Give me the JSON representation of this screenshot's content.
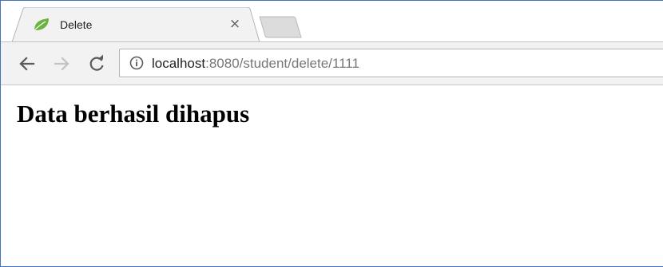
{
  "tab": {
    "title": "Delete",
    "close_glyph": "×",
    "favicon": "spring-leaf-icon",
    "favicon_color": "#6db33f"
  },
  "toolbar": {
    "back_icon": "arrow-left-icon",
    "forward_icon": "arrow-right-icon",
    "reload_icon": "reload-icon",
    "site_info_icon": "info-circle-icon"
  },
  "address_bar": {
    "host": "localhost",
    "rest": ":8080/student/delete/1111"
  },
  "page": {
    "heading": "Data berhasil dihapus"
  },
  "colors": {
    "window_border": "#4472c4",
    "toolbar_bg": "#f2f2f2",
    "url_host": "#222222",
    "url_path": "#777777"
  }
}
